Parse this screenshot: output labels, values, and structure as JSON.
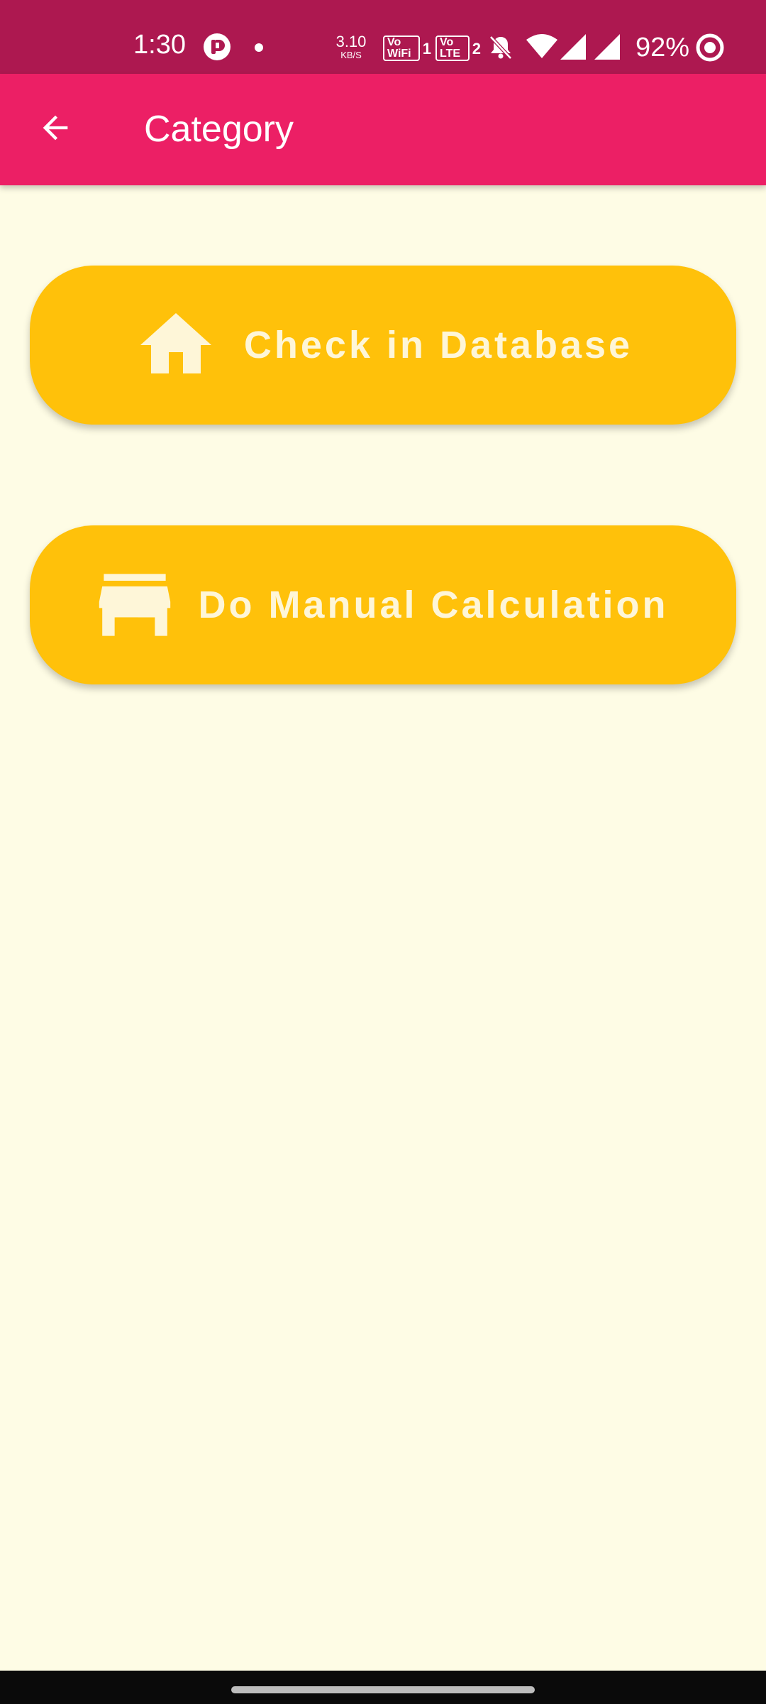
{
  "status_bar": {
    "time": "1:30",
    "net_speed_value": "3.10",
    "net_speed_unit": "KB/S",
    "sim1_label_top": "Vo",
    "sim1_label_bottom": "WiFi",
    "sim1_number": "1",
    "sim2_label_top": "Vo",
    "sim2_label_bottom": "LTE",
    "sim2_number": "2",
    "battery_percent": "92%",
    "icons": [
      "app-notification-icon",
      "dot-icon",
      "bell-off-icon",
      "wifi-icon",
      "signal-icon",
      "signal-icon",
      "battery-ring-icon"
    ]
  },
  "app_bar": {
    "title": "Category",
    "back_icon": "arrow-left-icon"
  },
  "buttons": [
    {
      "label": "Check in Database",
      "icon": "home-icon"
    },
    {
      "label": "Do Manual Calculation",
      "icon": "store-icon"
    }
  ],
  "colors": {
    "status_bar": "#AD1850",
    "app_bar": "#EC1F65",
    "background": "#FEFCE5",
    "button": "#FFC10A",
    "button_text": "#FEF6D8"
  }
}
